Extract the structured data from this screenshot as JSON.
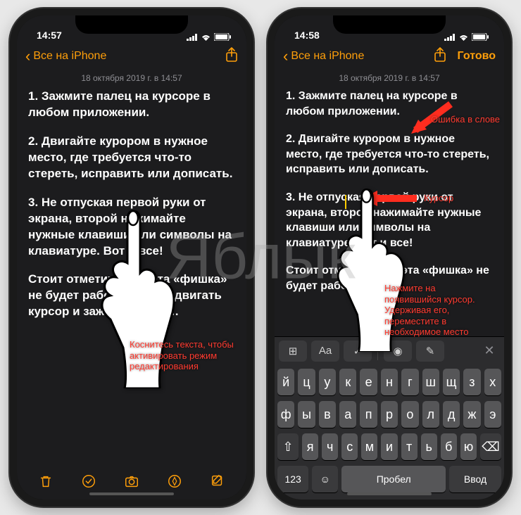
{
  "watermark": "Яблык",
  "status": {
    "time_left": "14:57",
    "time_right": "14:58"
  },
  "nav": {
    "back_label": "Все на iPhone",
    "done_label": "Готово"
  },
  "note": {
    "date": "18 октября 2019 г. в 14:57",
    "p1": "1. Зажмите палец на курсоре в любом приложении.",
    "p2": "2. Двигайте курором в нужное место, где требуется что-то стереть, исправить или дописать.",
    "p3_left": "3. Не отпуская первой руки от экрана, второй нажимайте нужные клавиши или символы на клавиатуре. Вот и все!",
    "p3_right": "3. Не отпуская первой руки от экрана, второй нажимайте нужные клавиши или символы на клавиатуре. Вот и все!",
    "p4_left": "Стоит отметить, что эта «фишка» не будет работать, если двигать курсор и зажатый проб…",
    "p4_right": "Стоит отметить, что эта «фишка» не будет работать,"
  },
  "annotations": {
    "left_tip": "Коснитесь текста, чтобы активировать режим редактиро­вания",
    "right_tip": "Нажмите на появившийся курсор. Удерживая его, переместите в необходимое место",
    "error_label": "Ошибка в слове",
    "cursor_label": "Курсор"
  },
  "toolbar": {
    "trash": "trash-icon",
    "check": "check-circle-icon",
    "camera": "camera-icon",
    "pen": "pen-tip-icon",
    "compose": "compose-icon"
  },
  "keyboard": {
    "row1": [
      "й",
      "ц",
      "у",
      "к",
      "е",
      "н",
      "г",
      "ш",
      "щ",
      "з",
      "х"
    ],
    "row2": [
      "ф",
      "ы",
      "в",
      "а",
      "п",
      "р",
      "о",
      "л",
      "д",
      "ж",
      "э"
    ],
    "row3_shift": "⇧",
    "row3": [
      "я",
      "ч",
      "с",
      "м",
      "и",
      "т",
      "ь",
      "б",
      "ю"
    ],
    "row3_del": "⌫",
    "func_123": "123",
    "func_emoji": "☺",
    "func_space": "Пробел",
    "func_return": "Ввод",
    "bar_table": "⊞",
    "bar_aa": "Aa",
    "bar_check": "✓",
    "bar_camera": "◉",
    "bar_pen": "✎",
    "bar_close": "✕"
  }
}
